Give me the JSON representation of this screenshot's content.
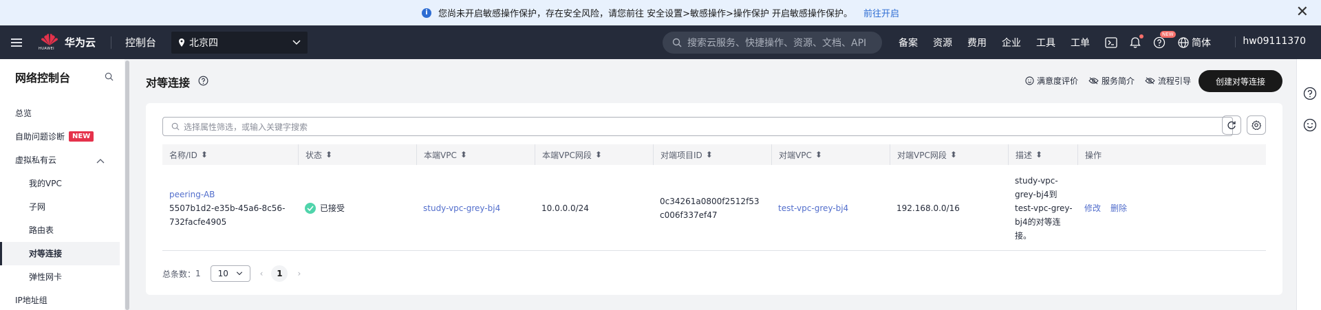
{
  "notice": {
    "icon": "info-icon",
    "message": "您尚未开启敏感操作保护，存在安全风险，请您前往 安全设置>敏感操作>操作保护 开启敏感操作保护。",
    "link": "前往开启",
    "close_icon": "close-icon"
  },
  "header": {
    "brand": "华为云",
    "brand_sub": "HUAWEI",
    "console": "控制台",
    "region": "北京四",
    "search_placeholder": "搜索云服务、快捷操作、资源、文档、API",
    "menu": [
      "备案",
      "资源",
      "费用",
      "企业",
      "工具",
      "工单"
    ],
    "new_tag": "NEW",
    "language": "简体",
    "username": "hw09111370"
  },
  "sidebar": {
    "title": "网络控制台",
    "items": [
      {
        "label": "总览"
      },
      {
        "label": "自助问题诊断",
        "badge": "NEW"
      },
      {
        "label": "虚拟私有云"
      },
      {
        "label": "我的VPC"
      },
      {
        "label": "子网"
      },
      {
        "label": "路由表"
      },
      {
        "label": "对等连接"
      },
      {
        "label": "弹性网卡"
      },
      {
        "label": "IP地址组"
      }
    ]
  },
  "page": {
    "title": "对等连接",
    "actions": [
      "满意度评价",
      "服务简介",
      "流程引导"
    ],
    "create_button": "创建对等连接",
    "filter_placeholder": "选择属性筛选，或输入关键字搜索"
  },
  "table": {
    "columns": [
      "名称/ID",
      "状态",
      "本端VPC",
      "本端VPC网段",
      "对端项目ID",
      "对端VPC",
      "对端VPC网段",
      "描述",
      "操作"
    ],
    "rows": [
      {
        "name": "peering-AB",
        "id_line1": "5507b1d2-e35b-45a6-8c56-",
        "id_line2": "732facfe4905",
        "status": "已接受",
        "local_vpc": "study-vpc-grey-bj4",
        "local_cidr": "10.0.0.0/24",
        "peer_project_line1": "0c34261a0800f2512f53",
        "peer_project_line2": "c006f337ef47",
        "peer_vpc": "test-vpc-grey-bj4",
        "peer_cidr": "192.168.0.0/16",
        "desc_lines": [
          "study-vpc-",
          "grey-bj4到",
          "test-vpc-grey-",
          "bj4的对等连",
          "接。"
        ],
        "op_modify": "修改",
        "op_delete": "删除"
      }
    ]
  },
  "pager": {
    "total_label": "总条数：",
    "total": "1",
    "page_size": "10",
    "current_page": "1"
  },
  "colors": {
    "header_bg": "#252b3a",
    "link": "#526ecc",
    "status_ok": "#50d4ab",
    "new_badge": "#e5324b"
  }
}
